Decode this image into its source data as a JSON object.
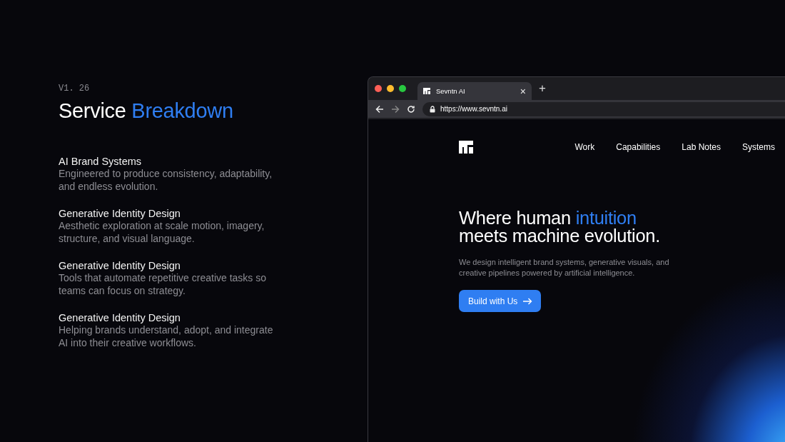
{
  "version": "V1. 26",
  "title": [
    {
      "text": "Service ",
      "accent": false
    },
    {
      "text": "Breakdown",
      "accent": true
    }
  ],
  "services": [
    {
      "name": "AI Brand Systems",
      "description": "Engineered to produce consistency, adaptability, and endless evolution."
    },
    {
      "name": "Generative Identity Design",
      "description": "Aesthetic exploration at scale motion, imagery, structure, and visual language."
    },
    {
      "name": "Generative Identity Design",
      "description": "Tools that automate repetitive creative tasks so teams can focus on strategy."
    },
    {
      "name": "Generative Identity Design",
      "description": "Helping brands understand, adopt, and integrate AI into their creative workflows."
    }
  ],
  "browser": {
    "tabs": [
      {
        "title": "Sevntn AI",
        "selected": true,
        "close": "×"
      }
    ],
    "new_tab": "+",
    "url": "https://www.sevntn.ai"
  },
  "site": {
    "nav": [
      "Work",
      "Capabilities",
      "Lab Notes",
      "Systems"
    ],
    "headline": [
      [
        {
          "text": "Where human ",
          "accent": false
        },
        {
          "text": "intuition",
          "accent": true
        }
      ],
      [
        {
          "text": "meets machine evolution.",
          "accent": false
        }
      ]
    ],
    "subtext": "We design intelligent brand systems, generative visuals, and creative pipelines powered by artificial intelligence.",
    "cta": "Build with Us"
  }
}
